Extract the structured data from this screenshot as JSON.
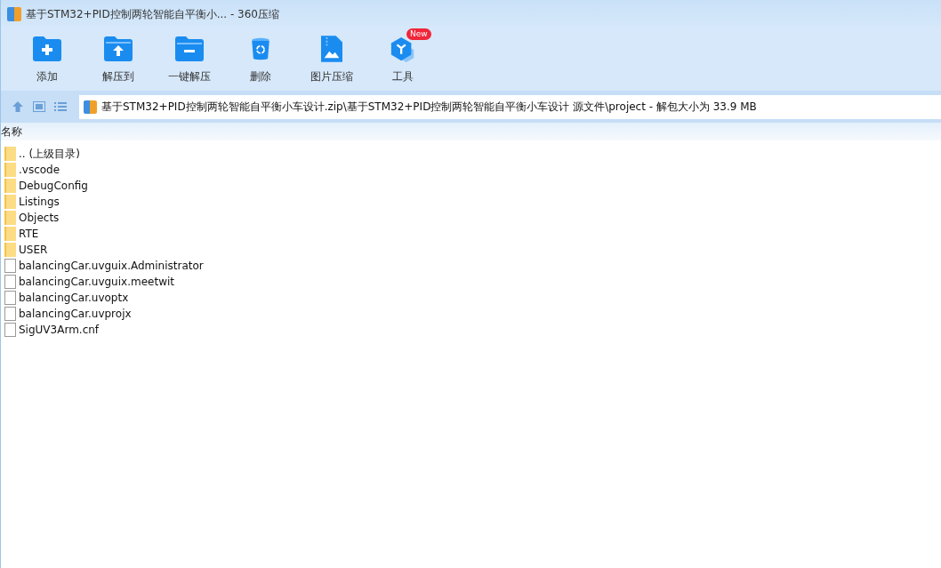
{
  "window": {
    "title": "基于STM32+PID控制两轮智能自平衡小... - 360压缩"
  },
  "toolbar": [
    {
      "label": "添加"
    },
    {
      "label": "解压到"
    },
    {
      "label": "一键解压"
    },
    {
      "label": "删除"
    },
    {
      "label": "图片压缩"
    },
    {
      "label": "工具",
      "badge": "New"
    }
  ],
  "address": {
    "value": "基于STM32+PID控制两轮智能自平衡小车设计.zip\\基于STM32+PID控制两轮智能自平衡小车设计 源文件\\project - 解包大小为 33.9 MB"
  },
  "table": {
    "columns": [
      "名称"
    ],
    "rows": [
      {
        "kind": "folder",
        "name": ".. (上级目录)"
      },
      {
        "kind": "folder",
        "name": ".vscode"
      },
      {
        "kind": "folder",
        "name": "DebugConfig"
      },
      {
        "kind": "folder",
        "name": "Listings"
      },
      {
        "kind": "folder",
        "name": "Objects"
      },
      {
        "kind": "folder",
        "name": "RTE"
      },
      {
        "kind": "folder",
        "name": "USER"
      },
      {
        "kind": "file",
        "name": "balancingCar.uvguix.Administrator"
      },
      {
        "kind": "file",
        "name": "balancingCar.uvguix.meetwit"
      },
      {
        "kind": "file",
        "name": "balancingCar.uvoptx"
      },
      {
        "kind": "file",
        "name": "balancingCar.uvprojx"
      },
      {
        "kind": "file",
        "name": "SigUV3Arm.cnf"
      }
    ]
  }
}
